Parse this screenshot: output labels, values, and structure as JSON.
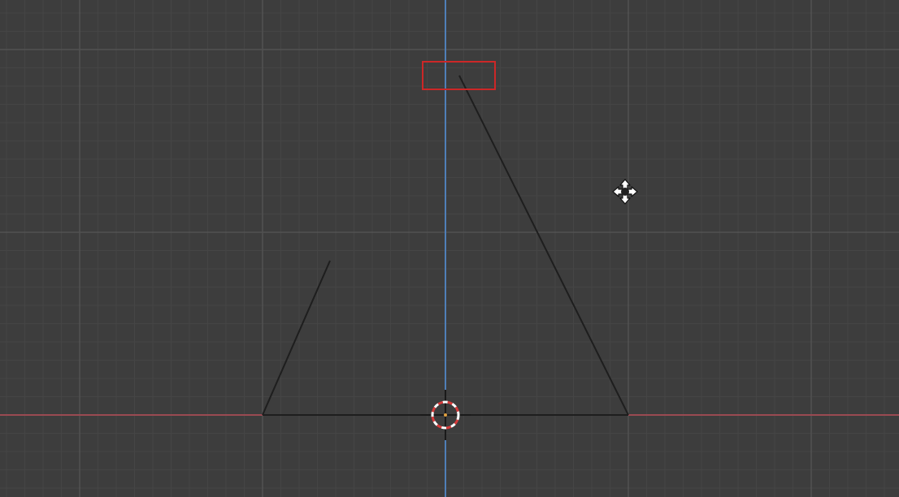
{
  "viewport": {
    "view": "front-orthographic",
    "background_color": "#3d3d3d",
    "grid": {
      "visible": true,
      "minor_line_color": "#454545",
      "major_line_color": "#525252"
    },
    "axes": {
      "x_axis_color": "#9a4a52",
      "z_axis_color": "#4f7fb8"
    }
  },
  "mesh": {
    "edge_color": "#1e1e1e",
    "edge_count": 3,
    "vertex_count": 5
  },
  "selection_box": {
    "visible": true,
    "color": "#cc2727"
  },
  "cursor": {
    "type": "move-cursor",
    "color": "#ffffff"
  },
  "origin_marker": {
    "name": "3d-cursor",
    "ring_colors": [
      "#ffffff",
      "#d63a3a"
    ]
  }
}
